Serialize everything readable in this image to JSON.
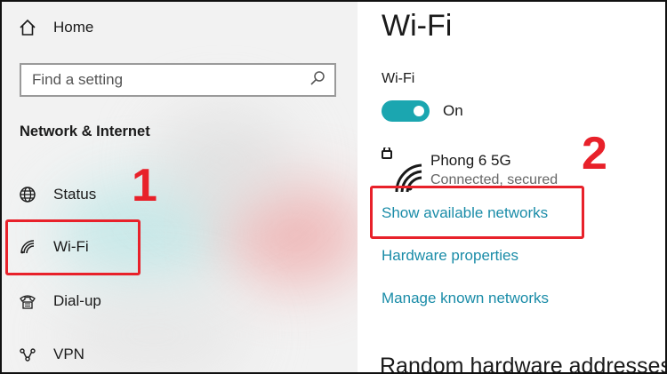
{
  "sidebar": {
    "home_label": "Home",
    "search_placeholder": "Find a setting",
    "section_title": "Network & Internet",
    "items": [
      {
        "label": "Status",
        "icon": "globe-icon"
      },
      {
        "label": "Wi-Fi",
        "icon": "wifi-icon"
      },
      {
        "label": "Dial-up",
        "icon": "phone-icon"
      },
      {
        "label": "VPN",
        "icon": "vpn-icon"
      }
    ]
  },
  "main": {
    "title": "Wi-Fi",
    "wifi_label": "Wi-Fi",
    "toggle_state": "On",
    "network": {
      "name": "Phong 6 5G",
      "status": "Connected, secured",
      "icon": "wifi-lock-icon"
    },
    "links": [
      "Show available networks",
      "Hardware properties",
      "Manage known networks"
    ],
    "bottom_heading": "Random hardware addresses"
  },
  "annotations": {
    "step1": "1",
    "step2": "2"
  },
  "colors": {
    "accent": "#1ba6b0",
    "link": "#1a8ca8",
    "annotation": "#e8212a"
  }
}
